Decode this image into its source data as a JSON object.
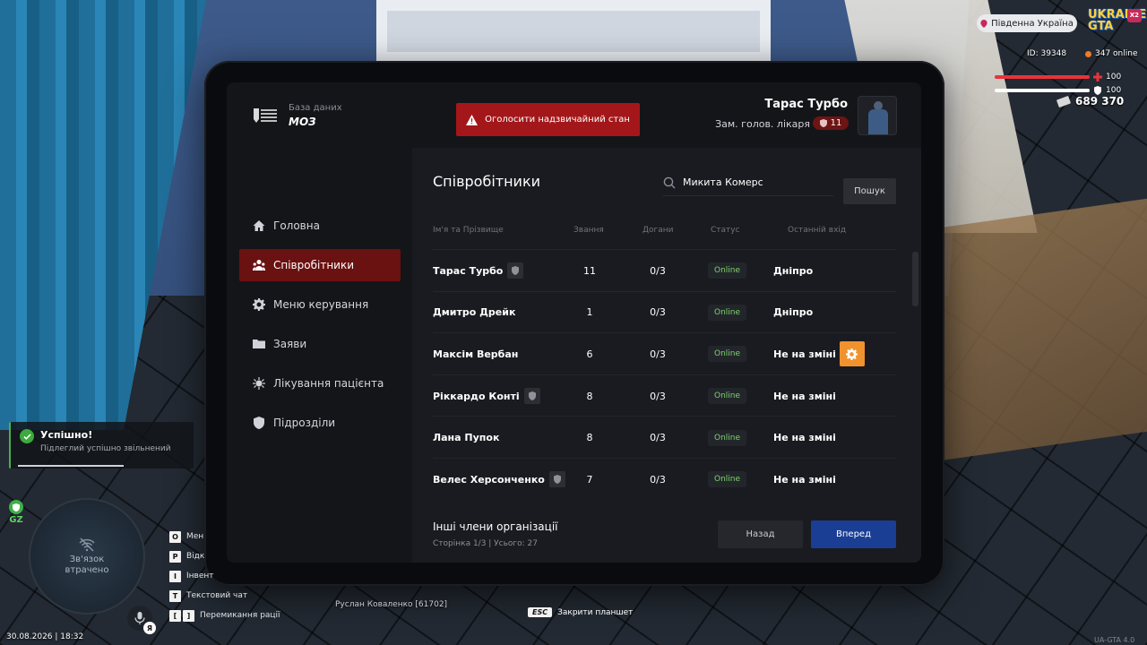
{
  "hud": {
    "region": "Південна Україна",
    "logo": "UKRAINE GTA",
    "server_badge": "X2",
    "id_text": "ID: 39348",
    "online_text": "347 online",
    "health": 100,
    "armor": 100,
    "health_label": "100",
    "armor_label": "100",
    "money": "689 370",
    "colors": {
      "health": "#e8333b",
      "armor": "#ffffff",
      "online_dot": "#f07a2a"
    }
  },
  "tablet": {
    "logo_subtitle": "База даних",
    "logo_title": "МОЗ",
    "emergency_button": "Оголосити надзвичайний стан",
    "profile": {
      "name": "Тарас Турбо",
      "rank_title": "Зам. голов. лікаря",
      "rank_number": "11"
    },
    "nav": [
      {
        "label": "Головна",
        "icon": "home-icon",
        "active": false
      },
      {
        "label": "Співробітники",
        "icon": "users-icon",
        "active": true
      },
      {
        "label": "Меню керування",
        "icon": "gear-icon",
        "active": false
      },
      {
        "label": "Заяви",
        "icon": "folder-icon",
        "active": false
      },
      {
        "label": "Лікування пацієнта",
        "icon": "virus-icon",
        "active": false
      },
      {
        "label": "Підрозділи",
        "icon": "shield-icon",
        "active": false
      }
    ],
    "main": {
      "title": "Співробітники",
      "search_value": "Микита Комерс",
      "search_button": "Пошук",
      "columns": [
        "Ім'я та Прізвище",
        "Звання",
        "Догани",
        "Статус",
        "Останній вхід"
      ],
      "rows": [
        {
          "name": "Тарас Турбо",
          "shield": true,
          "rank": "11",
          "reprimands": "0/3",
          "status": "Online",
          "last": "Дніпро",
          "gear": false
        },
        {
          "name": "Дмитро Дрейк",
          "shield": false,
          "rank": "1",
          "reprimands": "0/3",
          "status": "Online",
          "last": "Дніпро",
          "gear": false
        },
        {
          "name": "Максім Вербан",
          "shield": false,
          "rank": "6",
          "reprimands": "0/3",
          "status": "Online",
          "last": "Не на зміні",
          "gear": true
        },
        {
          "name": "Ріккардо Конті",
          "shield": true,
          "rank": "8",
          "reprimands": "0/3",
          "status": "Online",
          "last": "Не на зміні",
          "gear": false
        },
        {
          "name": "Лана Пупок",
          "shield": false,
          "rank": "8",
          "reprimands": "0/3",
          "status": "Online",
          "last": "Не на зміні",
          "gear": false
        },
        {
          "name": "Велес Херсонченко",
          "shield": true,
          "rank": "7",
          "reprimands": "0/3",
          "status": "Online",
          "last": "Не на зміні",
          "gear": false
        }
      ],
      "footer_title": "Інші члени організації",
      "page_info": "Сторінка 1/3 | Усього: 27",
      "back_button": "Назад",
      "next_button": "Вперед"
    },
    "colors": {
      "accent_red": "#a3171a",
      "active_nav": "#6a1111",
      "next_blue": "#1b3e95",
      "online_green": "#7fd36d",
      "gear_orange": "#f0922e"
    }
  },
  "toast": {
    "title": "Успішно!",
    "message": "Підлеглий успішно звільнений"
  },
  "gz_label": "GZ",
  "minimap_text": "Зв'язок\nвтрачено",
  "mic_lang": "Я",
  "hotkeys": [
    {
      "key": "O",
      "label": "Мен"
    },
    {
      "key": "P",
      "label": "Відк"
    },
    {
      "key": "I",
      "label": "Інвент"
    },
    {
      "key": "T",
      "label": "Текстовий чат"
    },
    {
      "key": "[ ]",
      "label": "Перемикання рації"
    }
  ],
  "player_tag": "Руслан Коваленко [61702]",
  "esc_key": "ESC",
  "esc_hint": "Закрити планшет",
  "datetime": "30.08.2026 | 18:32",
  "version": "UA-GTA 4.0"
}
